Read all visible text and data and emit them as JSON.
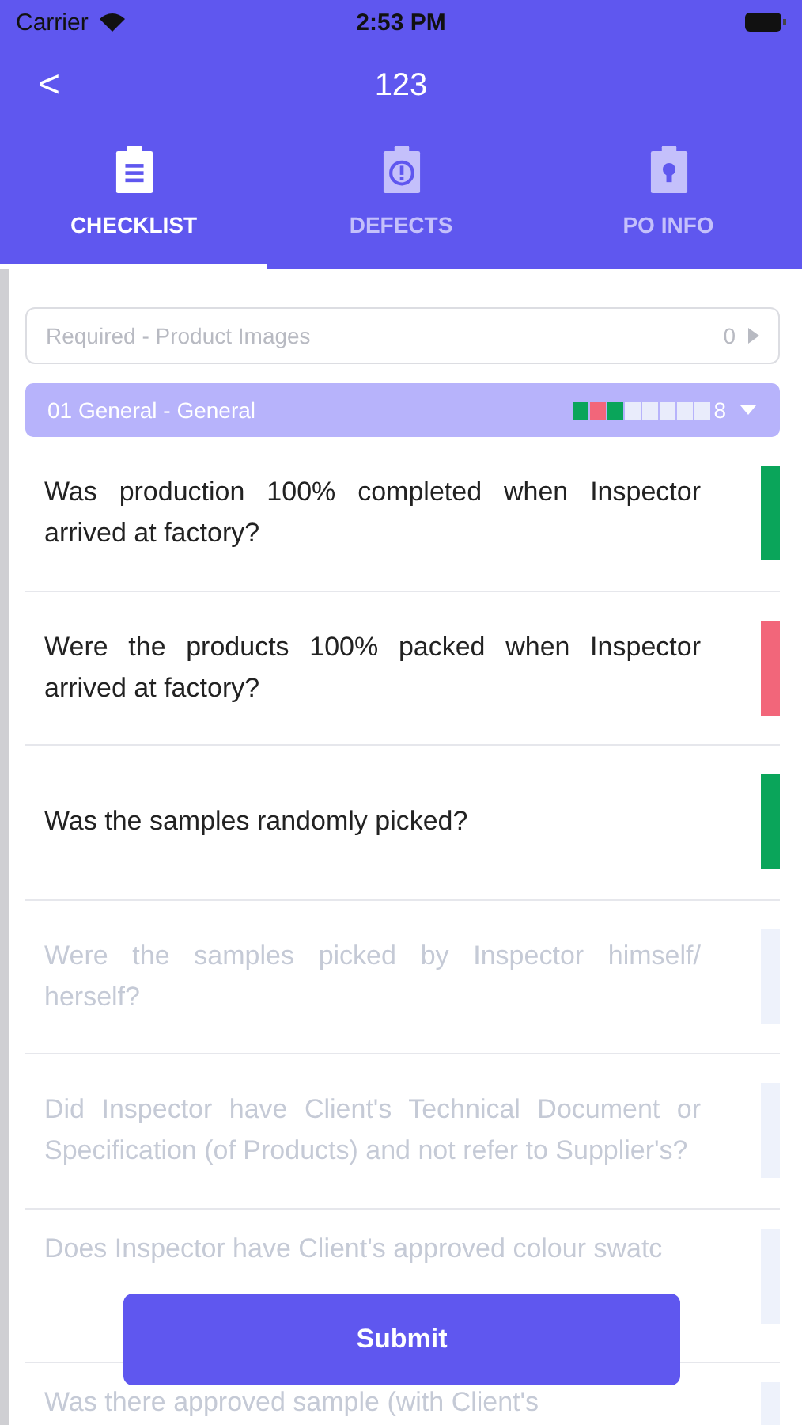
{
  "status_bar": {
    "carrier": "Carrier",
    "time": "2:53 PM"
  },
  "nav": {
    "back": "<",
    "title": "123"
  },
  "tabs": [
    {
      "label": "CHECKLIST",
      "selected": true
    },
    {
      "label": "DEFECTS",
      "selected": false
    },
    {
      "label": "PO INFO",
      "selected": false
    }
  ],
  "images_row": {
    "label": "Required - Product Images",
    "count": "0"
  },
  "section": {
    "title": "01 General - General",
    "count": "8",
    "expanded": true,
    "progress": [
      {
        "color": "#0aa55a"
      },
      {
        "color": "#f2667a"
      },
      {
        "color": "#0aa55a"
      },
      {
        "color": "#e9ecfb"
      },
      {
        "color": "#e9ecfb"
      },
      {
        "color": "#e9ecfb"
      },
      {
        "color": "#e9ecfb"
      },
      {
        "color": "#e9ecfb"
      }
    ]
  },
  "questions": [
    {
      "text": "Was production 100% completed when Inspector arrived at factory?",
      "color": "#0aa55a",
      "enabled": true
    },
    {
      "text": "Were the products 100% packed when Inspector arrived at factory?",
      "color": "#f2667a",
      "enabled": true
    },
    {
      "text": "Was the samples randomly picked?",
      "color": "#0aa55a",
      "enabled": true
    },
    {
      "text": "Were the samples picked by Inspector himself/ herself?",
      "color": "#eef2fb",
      "enabled": false
    },
    {
      "text": "Did Inspector have Client's Technical Document or Specification (of Products) and not refer to Supplier's?",
      "color": "#eef2fb",
      "enabled": false
    },
    {
      "text": "Does Inspector have Client's approved colour swatc",
      "color": "#eef2fb",
      "enabled": false
    },
    {
      "text": "Was there approved sample (with Client's",
      "color": "#eef2fb",
      "enabled": false
    }
  ],
  "submit": "Submit"
}
